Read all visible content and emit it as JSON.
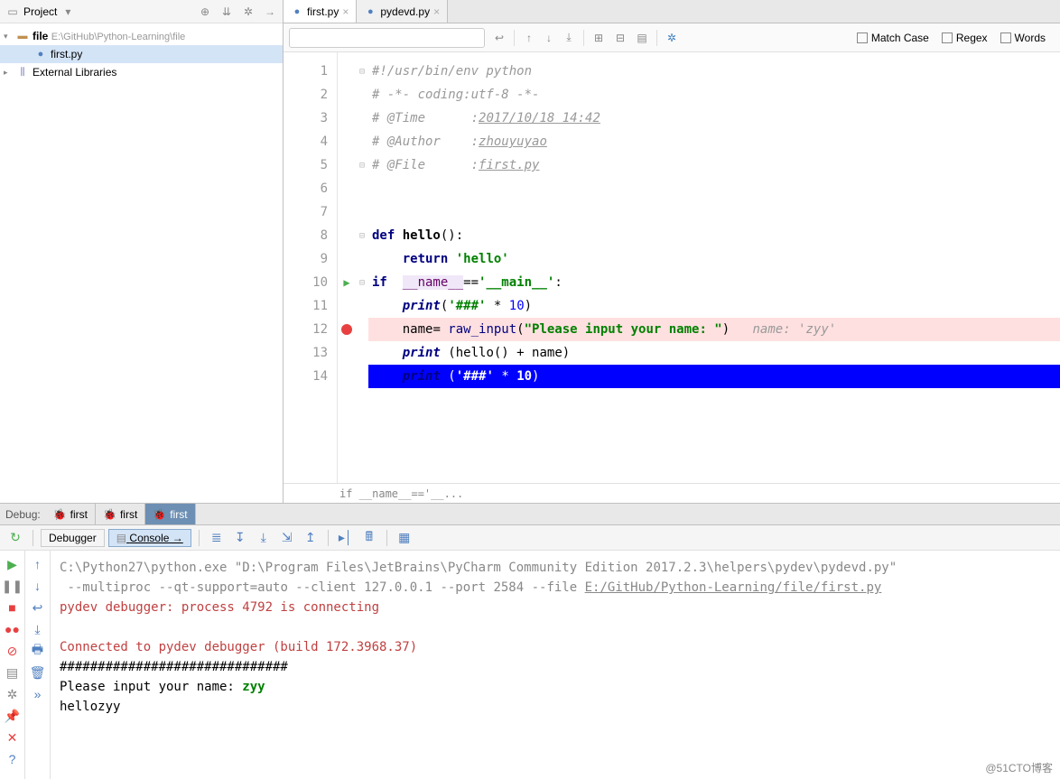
{
  "project": {
    "panel_title": "Project",
    "tree": {
      "root": {
        "name": "file",
        "path": "E:\\GitHub\\Python-Learning\\file"
      },
      "file": "first.py",
      "libraries": "External Libraries"
    }
  },
  "editor": {
    "tabs": [
      {
        "name": "first.py",
        "active": true
      },
      {
        "name": "pydevd.py",
        "active": false
      }
    ],
    "search": {
      "placeholder": "",
      "options": {
        "match_case": "Match Case",
        "regex": "Regex",
        "words": "Words"
      }
    },
    "lines": [
      "1",
      "2",
      "3",
      "4",
      "5",
      "6",
      "7",
      "8",
      "9",
      "10",
      "11",
      "12",
      "13",
      "14"
    ],
    "code": {
      "l1": "#!/usr/bin/env python",
      "l2": "# -*- coding:utf-8 -*-",
      "l3_a": "# @Time      :",
      "l3_b": "2017/10/18 14:42",
      "l4_a": "# @Author    :",
      "l4_b": "zhouyuyao",
      "l5_a": "# @File      :",
      "l5_b": "first.py",
      "l8_def": "def ",
      "l8_name": "hello",
      "l8_tail": "():",
      "l9_ret": "return ",
      "l9_str": "'hello'",
      "l10_if": "if",
      "l10_name": "__name__",
      "l10_eq": "==",
      "l10_main": "'__main__'",
      "l10_colon": ":",
      "l11_print": "print",
      "l11_open": "(",
      "l11_str": "'###'",
      "l11_mul": " * ",
      "l11_num": "10",
      "l11_close": ")",
      "l12_name": "name",
      "l12_eq": "= ",
      "l12_fn": "raw_input",
      "l12_open": "(",
      "l12_str": "\"Please input your name: \"",
      "l12_close": ")",
      "l12_hint": "name: 'zyy'",
      "l13_print": "print ",
      "l13_open": "(",
      "l13_hello": "hello() ",
      "l13_plus": "+ ",
      "l13_name": "name",
      "l13_close": ")",
      "l14_print": "print ",
      "l14_open": "(",
      "l14_str": "'###'",
      "l14_mul": " * ",
      "l14_num": "10",
      "l14_close": ")"
    },
    "breadcrumb": "if __name__=='__..."
  },
  "debug": {
    "label": "Debug:",
    "tabs": [
      "first",
      "first",
      "first"
    ],
    "active_tab": 2,
    "subtabs": {
      "debugger": "Debugger",
      "console": "Console"
    },
    "console_lines": {
      "cmd1": "C:\\Python27\\python.exe \"D:\\Program Files\\JetBrains\\PyCharm Community Edition 2017.2.3\\helpers\\pydev\\pydevd.py\"",
      "cmd2": " --multiproc --qt-support=auto --client 127.0.0.1 --port 2584 --file ",
      "cmd2_link": "E:/GitHub/Python-Learning/file/first.py",
      "conn1": "pydev debugger: process 4792 is connecting",
      "conn2": "Connected to pydev debugger (build 172.3968.37)",
      "hashes": "##############################",
      "prompt": "Please input your name: ",
      "input": "zyy",
      "out": "hellozyy"
    }
  },
  "watermark": "@51CTO博客"
}
